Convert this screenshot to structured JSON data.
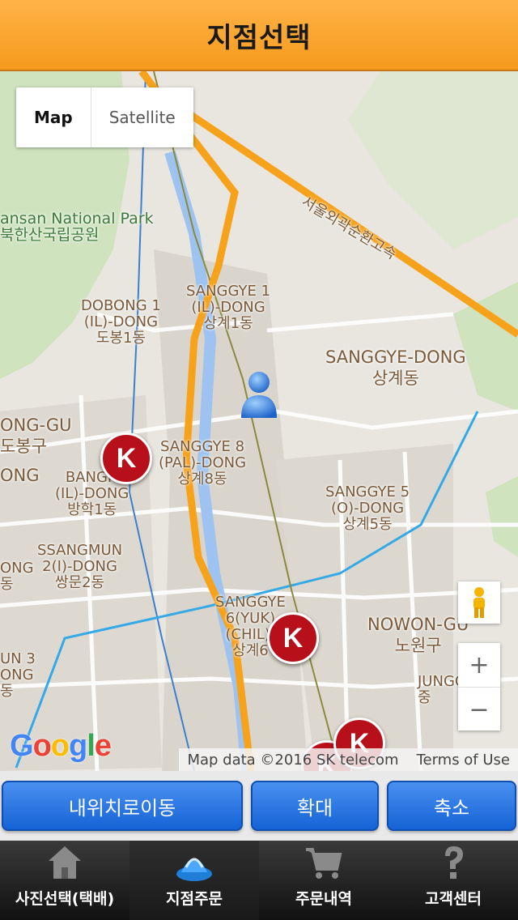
{
  "header": {
    "title": "지점선택"
  },
  "map": {
    "type_control": {
      "map_label": "Map",
      "satellite_label": "Satellite"
    },
    "labels": {
      "park_en": "ansan National Park",
      "park_ko": "북한산국립공원",
      "road": "서울외곽순환고속",
      "sanggye1": [
        "SANGGYE 1",
        "(IL)-DONG",
        "상계1동"
      ],
      "dobong1": [
        "DOBONG 1",
        "(IL)-DONG",
        "도봉1동"
      ],
      "sanggye_dong": [
        "SANGGYE-DONG",
        "상계동"
      ],
      "dobong_gu": [
        "ONG-GU",
        "도봉구"
      ],
      "sanggye8": [
        "SANGGYE 8",
        "(PAL)-DONG",
        "상계8동"
      ],
      "ong": [
        "ONG"
      ],
      "banghak1": [
        "BANGH",
        "(IL)-DONG",
        "방학1동"
      ],
      "sanggye5": [
        "SANGGYE 5",
        "(O)-DONG",
        "상계5동"
      ],
      "ssangmun2": [
        "SSANGMUN",
        "2(I)-DONG",
        "쌍문2동"
      ],
      "ong_left": [
        "ONG",
        "동"
      ],
      "sanggye6": [
        "SANGGYE",
        "6(YUK)",
        "(CHIL)-",
        "상계6"
      ],
      "nowon_gu": [
        "NOWON-GU",
        "노원구"
      ],
      "ssangmun3": [
        "UN 3",
        "ONG",
        "동"
      ],
      "junggye": [
        "JUNGGYE",
        "중"
      ]
    },
    "marker_letter": "K",
    "zoom_in": "+",
    "zoom_out": "−",
    "google_logo": [
      "G",
      "o",
      "o",
      "g",
      "l",
      "e"
    ],
    "google_colors": [
      "#4285f4",
      "#ea4335",
      "#fbbc05",
      "#4285f4",
      "#34a853",
      "#ea4335"
    ],
    "attribution": {
      "map_data": "Map data ©2016 SK telecom",
      "terms": "Terms of Use"
    }
  },
  "buttons": {
    "my_location": "내위치로이동",
    "zoom_in": "확대",
    "zoom_out": "축소"
  },
  "tabs": [
    {
      "label": "사진선택(택배)",
      "icon": "home-icon",
      "active": false
    },
    {
      "label": "지점주문",
      "icon": "branch-icon",
      "active": true
    },
    {
      "label": "주문내역",
      "icon": "cart-icon",
      "active": false
    },
    {
      "label": "고객센터",
      "icon": "question-icon",
      "active": false
    }
  ],
  "colors": {
    "header": "#f59a1c",
    "button": "#1563d6",
    "marker": "#b8101a",
    "highway": "#f7a21b"
  }
}
